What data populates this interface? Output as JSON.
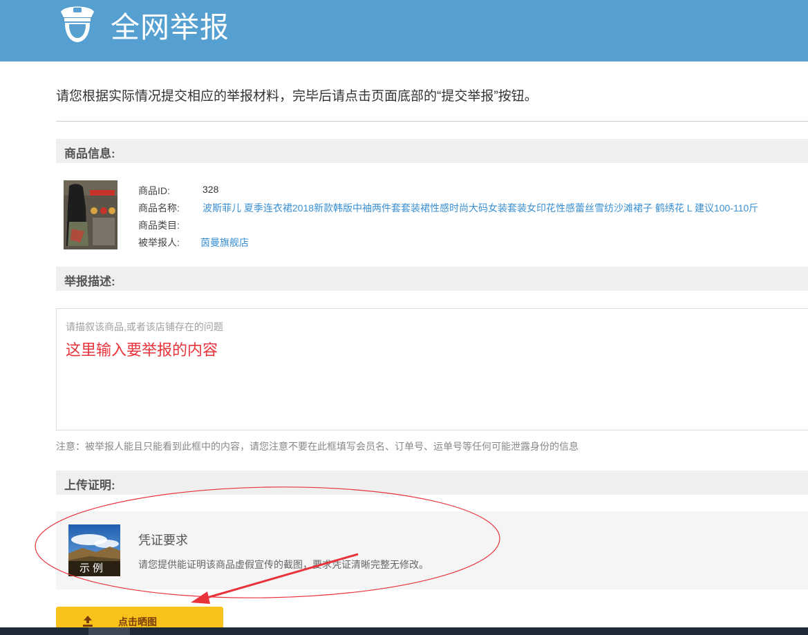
{
  "header": {
    "title": "全网举报"
  },
  "intro": "请您根据实际情况提交相应的举报材料，完毕后请点击页面底部的“提交举报”按钮。",
  "product_section": {
    "heading": "商品信息:",
    "id_label": "商品ID:",
    "id_value": "328",
    "name_label": "商品名称:",
    "name_value": "波斯菲儿 夏季连衣裙2018新款韩版中袖两件套套装裙性感时尚大码女装套装女印花性感蕾丝雪纺沙滩裙子 鹤绣花 L 建议100-110斤",
    "category_label": "商品类目:",
    "category_value": "",
    "reported_label": "被举报人:",
    "reported_value": "茵曼旗舰店"
  },
  "description_section": {
    "heading": "举报描述:",
    "placeholder": "请描叙该商品,或者该店铺存在的问题",
    "annotation": "这里输入要举报的内容",
    "notice": "注意：被举报人能且只能看到此框中的内容，请您注意不要在此框填写会员名、订单号、运单号等任何可能泄露身份的信息"
  },
  "upload_section": {
    "heading": "上传证明:",
    "example_label": "示例",
    "requirement_title": "凭证要求",
    "requirement_text": "请您提供能证明该商品虚假宣传的截图，要求凭证清晰完整无修改。",
    "button_label": "点击晒图"
  },
  "colors": {
    "header": "#559fd1",
    "link": "#3a8fd3",
    "annotation": "#e8333b",
    "button": "#f9c21a"
  },
  "icons": [
    "police-icon",
    "upload-icon"
  ]
}
